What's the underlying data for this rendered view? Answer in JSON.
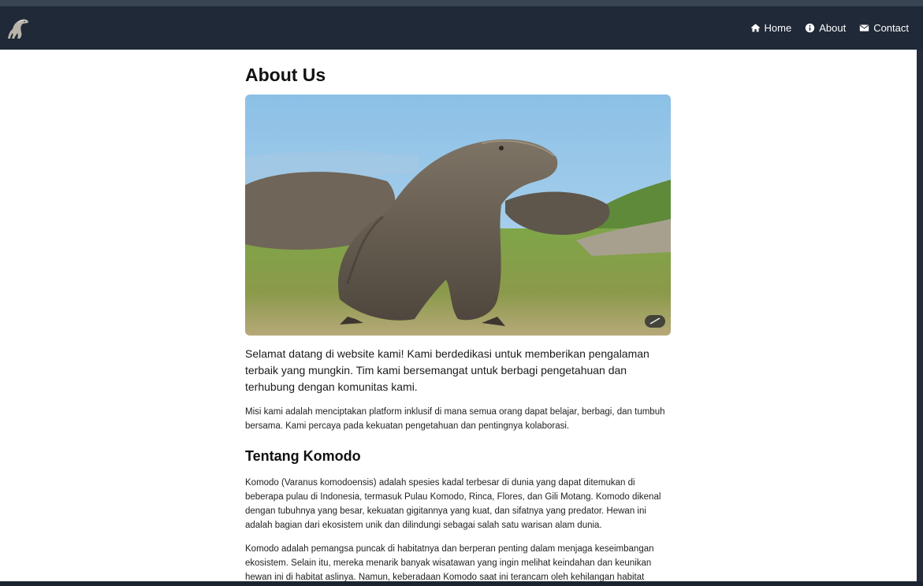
{
  "nav": {
    "items": [
      {
        "label": "Home",
        "icon": "home-icon"
      },
      {
        "label": "About",
        "icon": "info-icon"
      },
      {
        "label": "Contact",
        "icon": "envelope-icon"
      }
    ]
  },
  "main": {
    "title": "About Us",
    "intro": "Selamat datang di website kami! Kami berdedikasi untuk memberikan pengalaman terbaik yang mungkin. Tim kami bersemangat untuk berbagi pengetahuan dan terhubung dengan komunitas kami.",
    "mission": "Misi kami adalah menciptakan platform inklusif di mana semua orang dapat belajar, berbagi, dan tumbuh bersama. Kami percaya pada kekuatan pengetahuan dan pentingnya kolaborasi.",
    "section_title": "Tentang Komodo",
    "komodo_p1": "Komodo (Varanus komodoensis) adalah spesies kadal terbesar di dunia yang dapat ditemukan di beberapa pulau di Indonesia, termasuk Pulau Komodo, Rinca, Flores, dan Gili Motang. Komodo dikenal dengan tubuhnya yang besar, kekuatan gigitannya yang kuat, dan sifatnya yang predator. Hewan ini adalah bagian dari ekosistem unik dan dilindungi sebagai salah satu warisan alam dunia.",
    "komodo_p2": "Komodo adalah pemangsa puncak di habitatnya dan berperan penting dalam menjaga keseimbangan ekosistem. Selain itu, mereka menarik banyak wisatawan yang ingin melihat keindahan dan keunikan hewan ini di habitat aslinya. Namun, keberadaan Komodo saat ini terancam oleh kehilangan habitat"
  },
  "colors": {
    "navbar": "#1f2937",
    "page": "#ffffff",
    "sky": "#8fbfe3",
    "grass": "#7fa548"
  }
}
